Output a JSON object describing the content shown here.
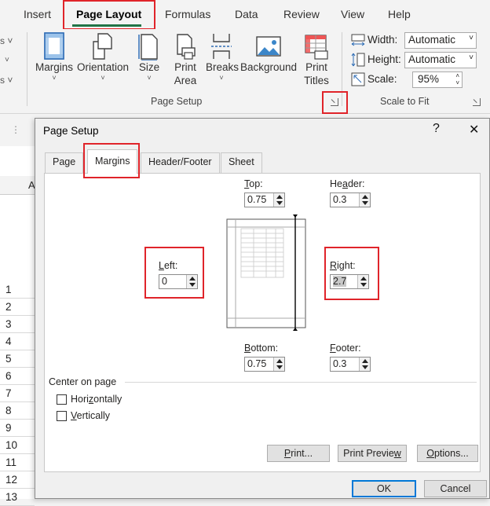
{
  "ribbon": {
    "tabs": [
      "Insert",
      "Page Layout",
      "Formulas",
      "Data",
      "Review",
      "View",
      "Help"
    ],
    "active_tab": "Page Layout",
    "page_setup": {
      "buttons": [
        {
          "id": "margins",
          "label": "Margins",
          "icon": "margins-icon"
        },
        {
          "id": "orientation",
          "label": "Orientation",
          "icon": "orientation-icon"
        },
        {
          "id": "size",
          "label": "Size",
          "icon": "size-icon"
        },
        {
          "id": "print_area",
          "label_1": "Print",
          "label_2": "Area",
          "icon": "print-area-icon"
        },
        {
          "id": "breaks",
          "label": "Breaks",
          "icon": "breaks-icon"
        },
        {
          "id": "background",
          "label": "Background",
          "icon": "background-icon"
        },
        {
          "id": "print_titles",
          "label_1": "Print",
          "label_2": "Titles",
          "icon": "print-titles-icon"
        }
      ],
      "group_label": "Page Setup"
    },
    "scale_to_fit": {
      "width_label": "Width:",
      "width_value": "Automatic",
      "height_label": "Height:",
      "height_value": "Automatic",
      "scale_label": "Scale:",
      "scale_value": "95%",
      "group_label": "Scale to Fit"
    }
  },
  "sheet": {
    "rows": [
      "1",
      "2",
      "3",
      "4",
      "5",
      "6",
      "7",
      "8",
      "9",
      "10",
      "11",
      "12",
      "13"
    ],
    "column_fragment": "A"
  },
  "dialog": {
    "title": "Page Setup",
    "help_glyph": "?",
    "close_glyph": "✕",
    "tabs": [
      "Page",
      "Margins",
      "Header/Footer",
      "Sheet"
    ],
    "active_tab": "Margins",
    "margins": {
      "top": {
        "accel": "T",
        "rest": "op:",
        "value": "0.75"
      },
      "header": {
        "pre": "He",
        "accel": "a",
        "rest": "der:",
        "value": "0.3"
      },
      "left": {
        "accel": "L",
        "rest": "eft:",
        "value": "0"
      },
      "right": {
        "accel": "R",
        "rest": "ight:",
        "value": "2.7"
      },
      "bottom": {
        "accel": "B",
        "rest": "ottom:",
        "value": "0.75"
      },
      "footer": {
        "accel": "F",
        "rest": "ooter:",
        "value": "0.3"
      }
    },
    "center_on_page": {
      "label": "Center on page",
      "horizontally": {
        "pre": "Hori",
        "accel": "z",
        "rest": "ontally",
        "checked": false
      },
      "vertically": {
        "accel": "V",
        "rest": "ertically",
        "checked": false
      }
    },
    "buttons": {
      "print": {
        "accel": "P",
        "rest": "rint..."
      },
      "print_preview": {
        "pre": "Print Previe",
        "accel": "w",
        "rest": ""
      },
      "options": {
        "accel": "O",
        "rest": "ptions..."
      },
      "ok": "OK",
      "cancel": "Cancel"
    }
  }
}
